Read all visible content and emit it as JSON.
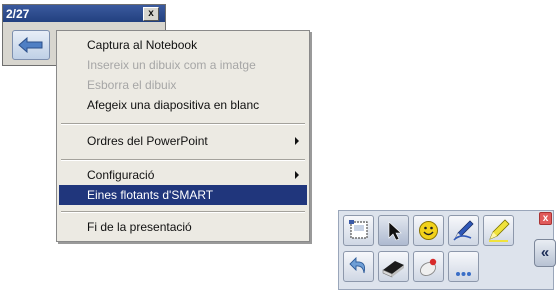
{
  "navigator": {
    "slide_counter": "2/27",
    "close_glyph": "x",
    "back_button_icon": "left-arrow-icon"
  },
  "menu": {
    "items": [
      {
        "label": "Captura al Notebook",
        "state": "enabled"
      },
      {
        "label": "Insereix un dibuix com a imatge",
        "state": "disabled"
      },
      {
        "label": "Esborra el dibuix",
        "state": "disabled"
      },
      {
        "label": "Afegeix una diapositiva en blanc",
        "state": "enabled"
      },
      {
        "label": "Ordres del PowerPoint",
        "state": "enabled",
        "submenu": true
      },
      {
        "label": "Configuració",
        "state": "enabled",
        "submenu": true
      },
      {
        "label": "Eines flotants d'SMART",
        "state": "selected"
      },
      {
        "label": "Fi de la presentació",
        "state": "enabled"
      }
    ]
  },
  "palette": {
    "close_glyph": "x",
    "expand_glyph": "«",
    "tools": [
      "screen-capture-icon",
      "select-arrow-icon",
      "smiley-stamp-icon",
      "blue-pen-icon",
      "yellow-highlighter-icon",
      "undo-icon",
      "eraser-icon",
      "ink-dropper-icon",
      "more-tools-icon"
    ]
  },
  "colors": {
    "title_bar": "#2b4a8c",
    "menu_highlight": "#20367c",
    "menu_background": "#eceae3",
    "disabled_text": "#a6a6a6"
  }
}
